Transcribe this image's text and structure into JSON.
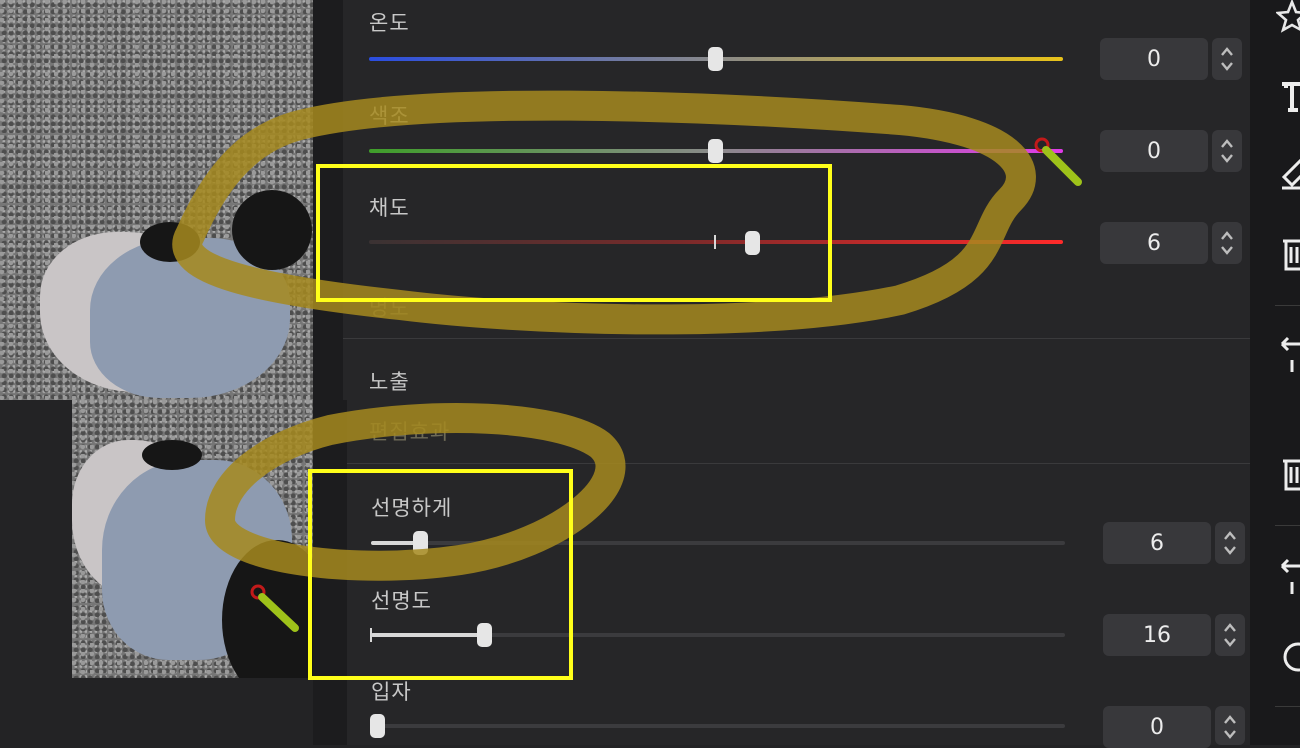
{
  "top_panel": {
    "sliders": [
      {
        "label": "온도",
        "value": "0",
        "level": 0.5
      },
      {
        "label": "색조",
        "value": "0",
        "level": 0.5
      },
      {
        "label": "채도",
        "value": "6",
        "level": 0.556
      }
    ],
    "hidden_label": "명도",
    "section_label": "노출",
    "stub_label": "편집효과"
  },
  "bottom_panel": {
    "sliders": [
      {
        "label": "선명하게",
        "value": "6",
        "level": 0.06
      },
      {
        "label": "선명도",
        "value": "16",
        "level": 0.16
      },
      {
        "label": "입자",
        "value": "0",
        "level": 0.0
      }
    ]
  },
  "toolbar": {
    "icons": [
      "star-icon",
      "text-icon",
      "eraser-icon",
      "trash-icon",
      "undo-icon",
      "trash-icon",
      "undo-icon",
      "shape-icon"
    ]
  },
  "colors": {
    "annotation_highlight": "#ffff1a",
    "annotation_marker": "#a68a1e",
    "temperature_cool": "#2a4de0",
    "temperature_warm": "#e8c21a",
    "tint_green": "#3f9e2a",
    "tint_magenta": "#e03ae8",
    "saturation_red": "#ff2a2a"
  }
}
